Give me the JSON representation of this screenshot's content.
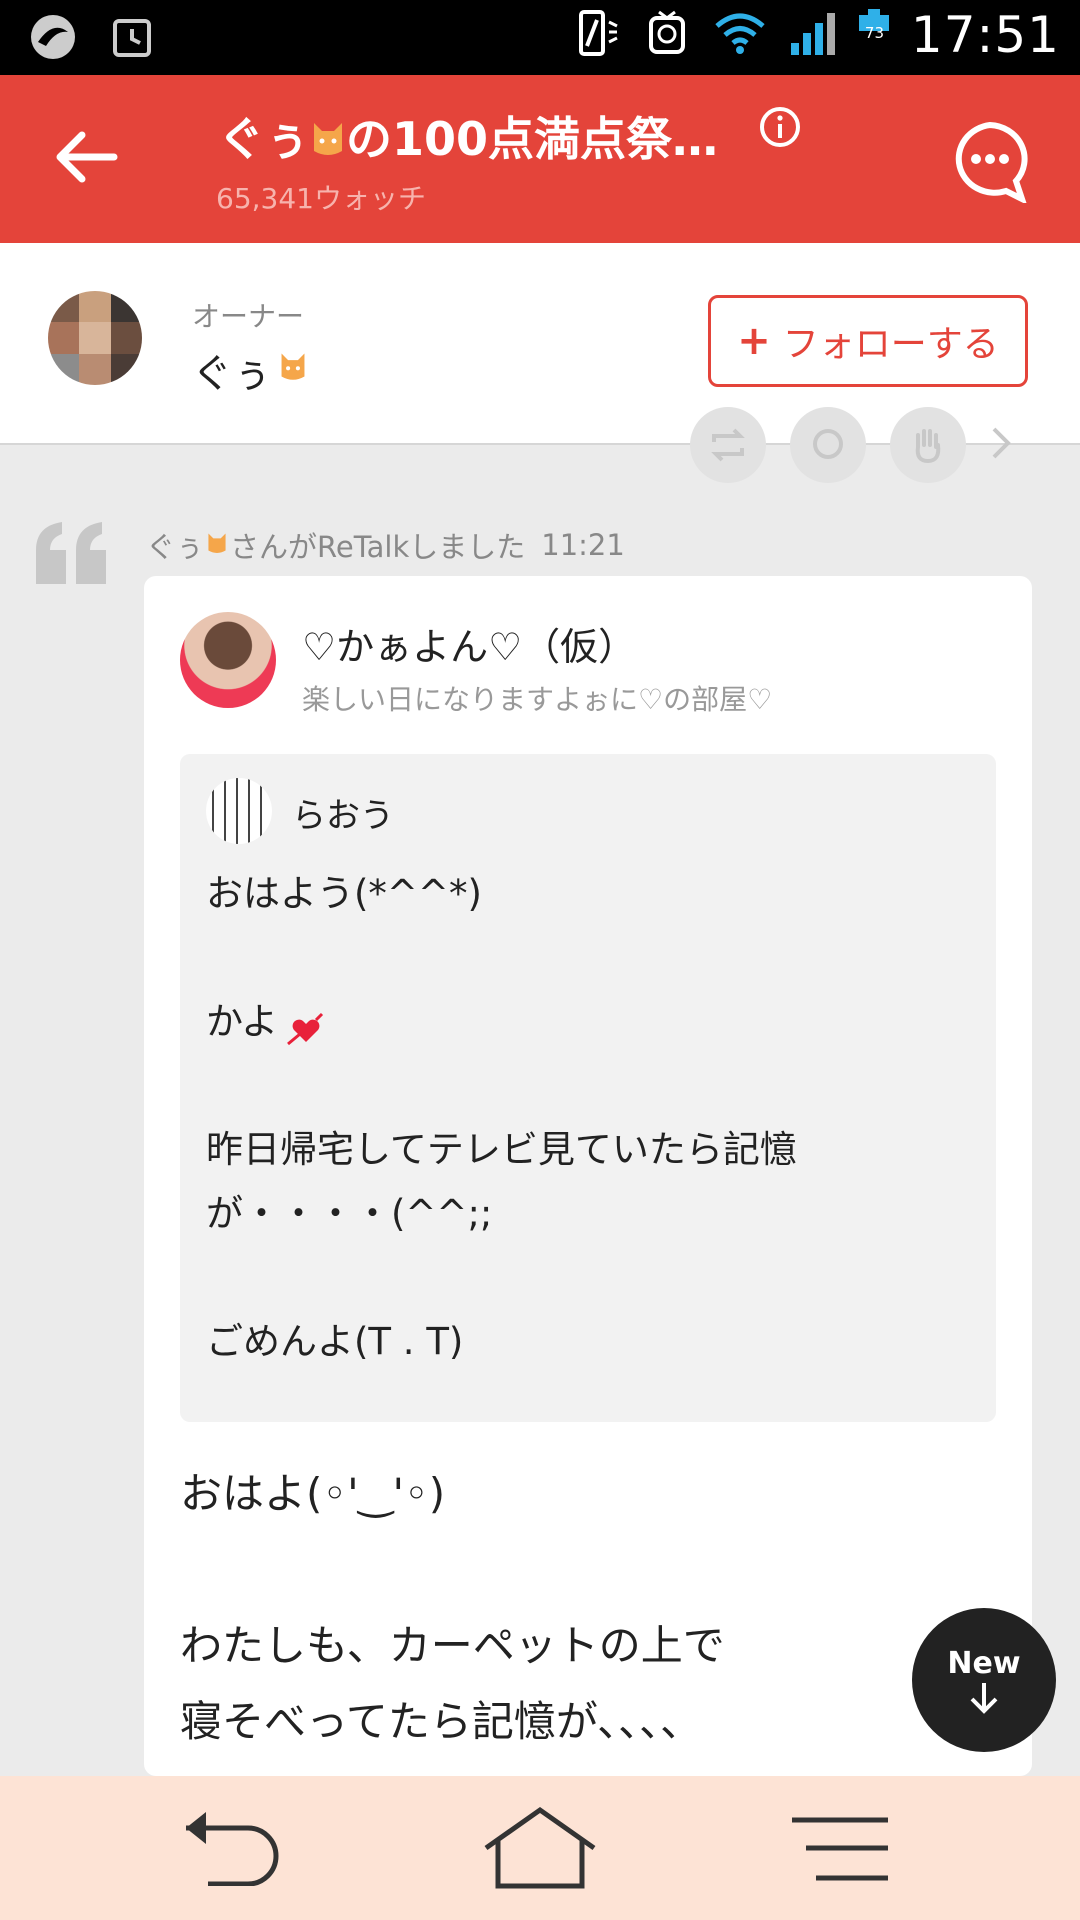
{
  "status_bar": {
    "time": "17:51",
    "battery_level": "73",
    "icons": [
      "app-swirl-icon",
      "alarm-icon",
      "vibrate-icon",
      "notification-icon",
      "wifi-icon",
      "signal-icon",
      "battery-icon"
    ]
  },
  "app_bar": {
    "title": "ぐぅ",
    "title_suffix": "の100点満点祭…",
    "watch_count": "65,341ウォッチ",
    "accent_color": "#e4443a"
  },
  "owner": {
    "label": "オーナー",
    "name": "ぐぅ",
    "follow_label": "フォローする"
  },
  "retalk": {
    "text": "さんがReTalkしました",
    "name": "ぐぅ",
    "time": "11:21"
  },
  "post": {
    "author_name": "♡かぁよん♡（仮）",
    "author_room": "楽しい日になりますよぉに♡の部屋♡",
    "quoted": {
      "author": "らおう",
      "body": "おはよう(*^^*)\n\nかよ\n\n昨日帰宅してテレビ見ていたら記憶\nが・・・・(^^;;\n\nごめんよ(T . T)"
    },
    "reply": "おはよ(◦'‿'◦)\n\nわたしも、カーペットの上で\n寝そべってたら記憶が、、、、"
  },
  "new_button": {
    "label": "New"
  }
}
